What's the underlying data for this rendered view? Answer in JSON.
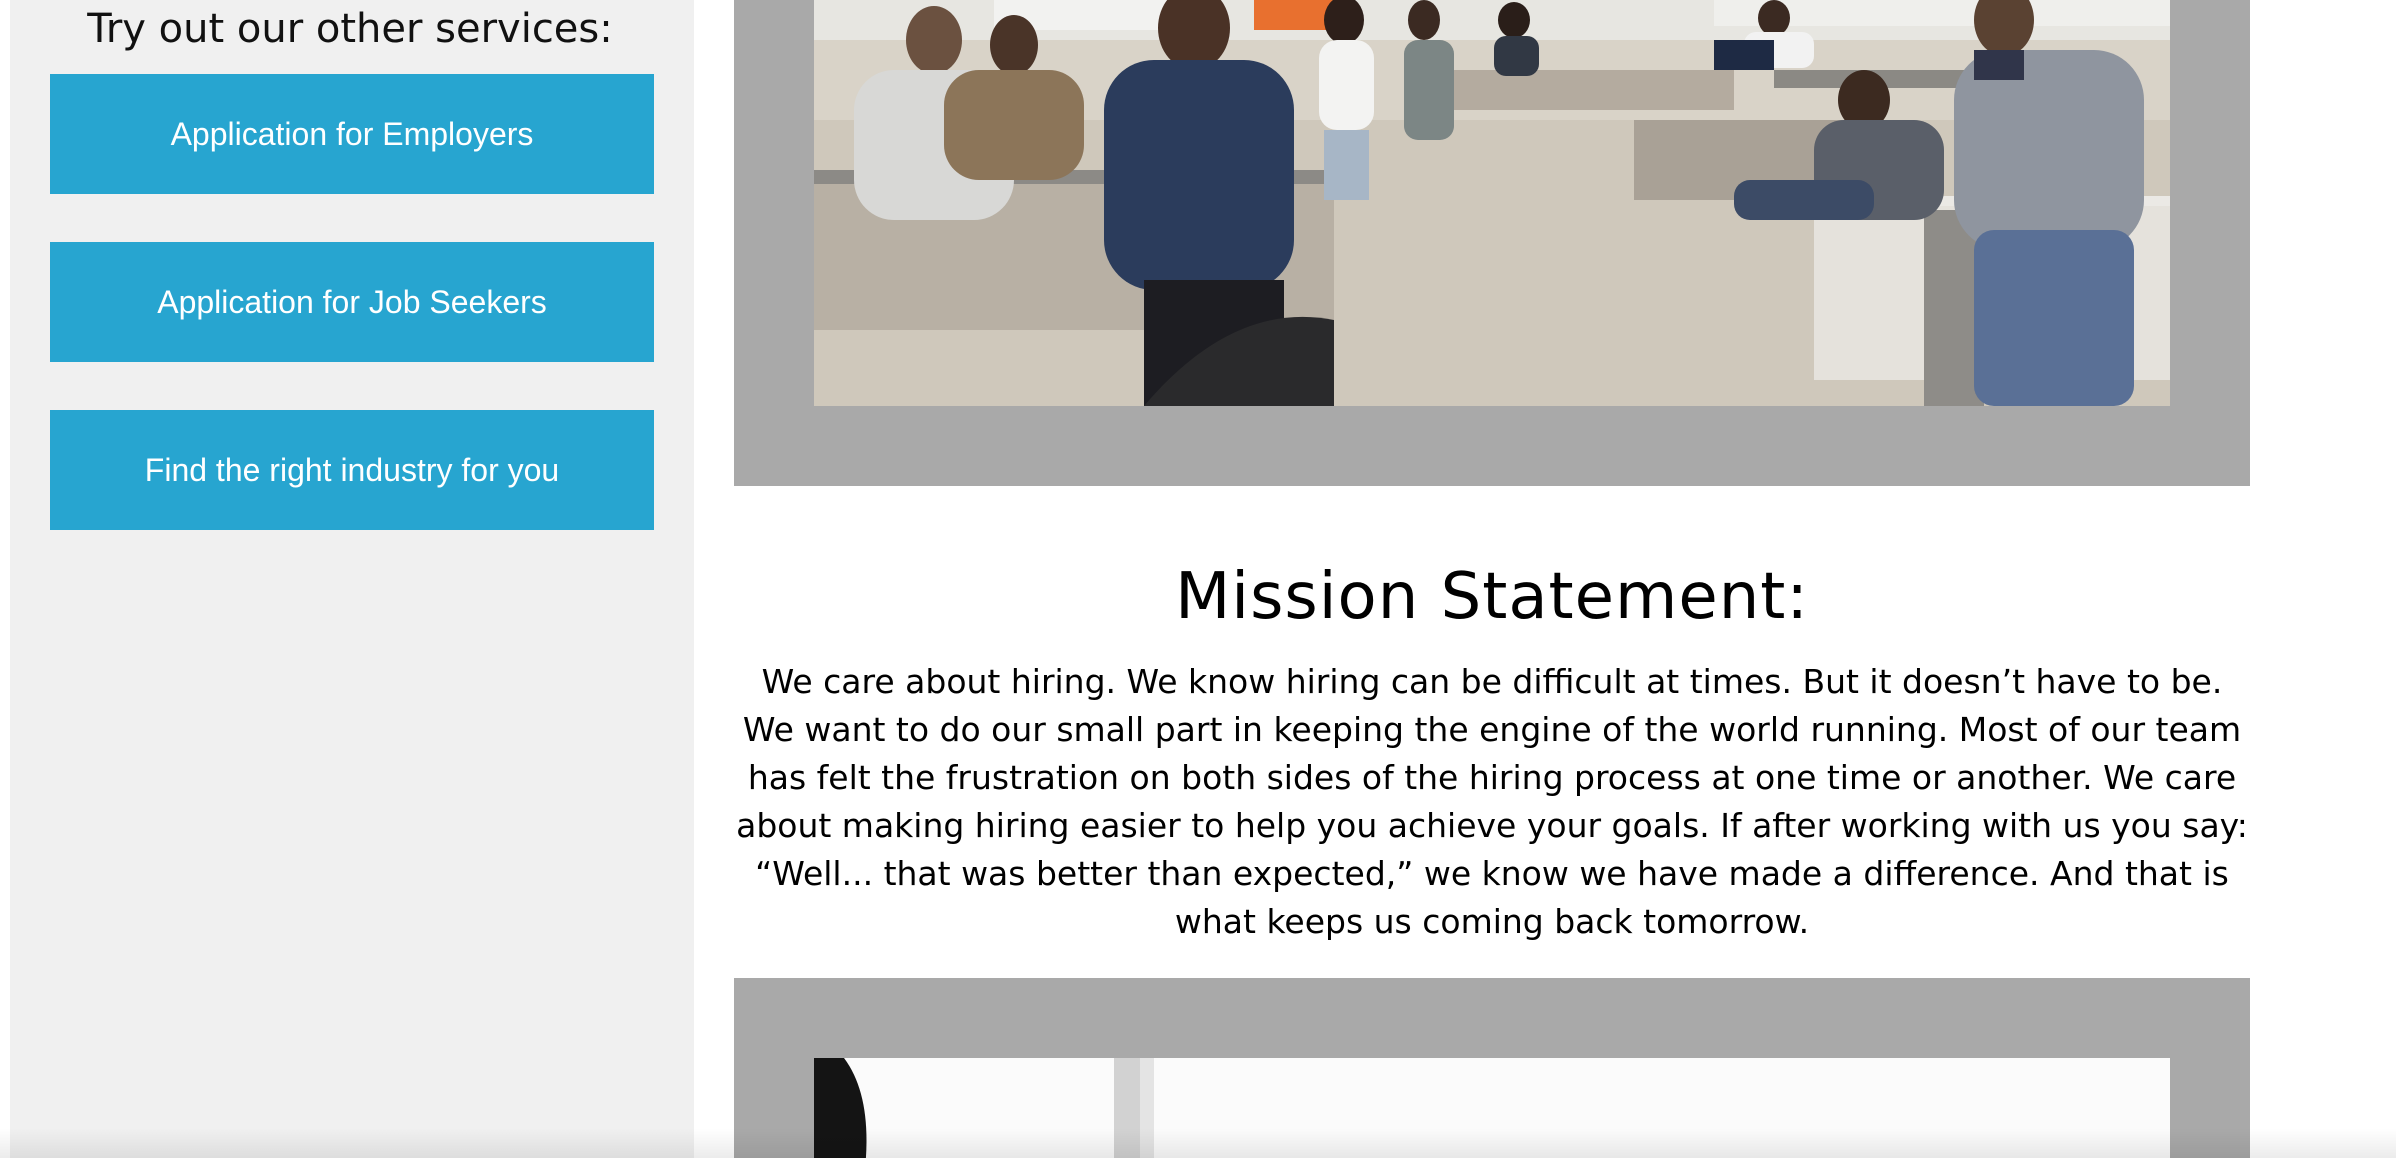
{
  "sidebar": {
    "title": "Try out our other services:",
    "buttons": [
      {
        "label": "Application for Employers"
      },
      {
        "label": "Application for Job Seekers"
      },
      {
        "label": "Find the right industry for you"
      }
    ]
  },
  "mission": {
    "title": "Mission Statement:",
    "body": "We care about hiring. We know hiring can be difficult at times. But it doesn’t have to be. We want to do our small part in keeping the engine of the world running. Most of our team has felt the frustration on both sides of the hiring process at one time or another. We care about making hiring easier to help you achieve your goals. If after working with us you say: “Well... that was better than expected,” we know we have made a difference. And that is what keeps us coming back tomorrow."
  },
  "colors": {
    "button_bg": "#27a5d0",
    "sidebar_bg": "#f0f0f0",
    "frame_bg": "#a9a9a9"
  }
}
